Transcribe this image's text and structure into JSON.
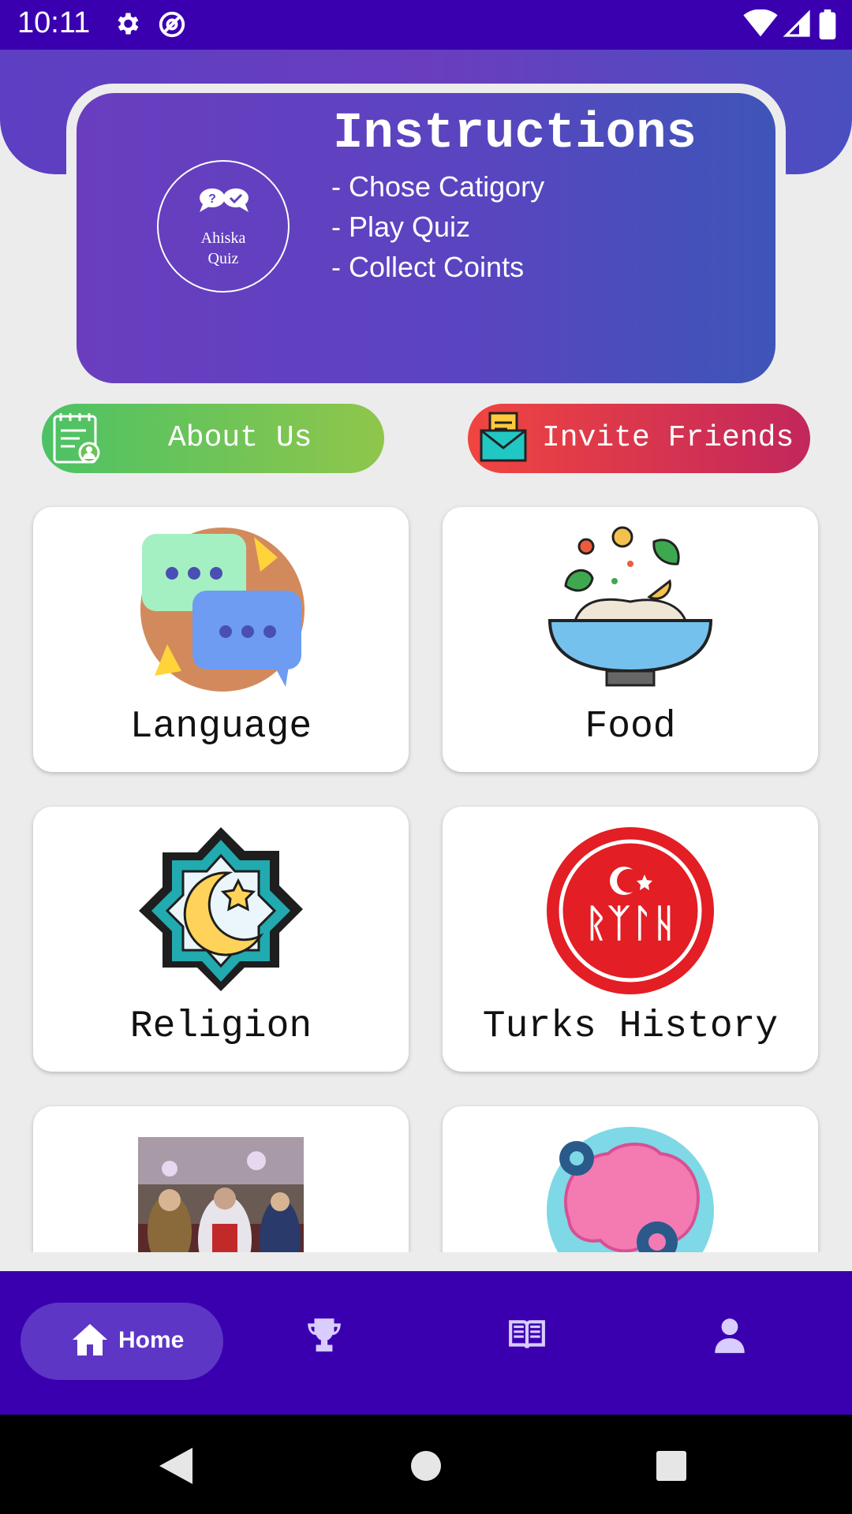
{
  "status_bar": {
    "time": "10:11"
  },
  "instructions": {
    "logo_text": "Ahiska\nQuiz",
    "title": "Instructions",
    "lines": [
      "- Chose Catigory",
      "- Play Quiz",
      "- Collect Coints"
    ]
  },
  "buttons": {
    "about": "About Us",
    "invite": "Invite Friends"
  },
  "categories": [
    {
      "label": "Language",
      "icon": "chat-bubbles-icon"
    },
    {
      "label": "Food",
      "icon": "food-bowl-icon"
    },
    {
      "label": "Religion",
      "icon": "crescent-star-icon"
    },
    {
      "label": "Turks History",
      "icon": "turkic-emblem-icon"
    },
    {
      "label": "",
      "icon": "wedding-photo"
    },
    {
      "label": "",
      "icon": "brain-gears-icon"
    }
  ],
  "nav": {
    "home": "Home",
    "items": [
      "home-icon",
      "trophy-icon",
      "book-icon",
      "profile-icon"
    ]
  },
  "colors": {
    "primary": "#3a00b0",
    "accent": "#6a3dbf",
    "about": "#4cc265",
    "invite": "#f04540"
  }
}
